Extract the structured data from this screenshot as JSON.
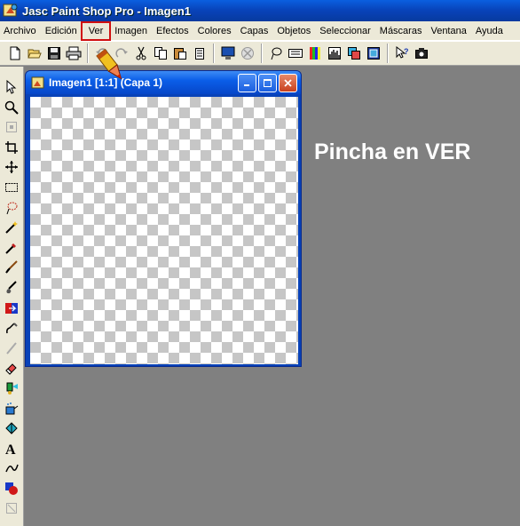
{
  "window": {
    "title": "Jasc Paint Shop Pro - Imagen1",
    "app_icon": "paint-shop-pro-icon"
  },
  "menu": {
    "items": [
      "Archivo",
      "Edición",
      "Ver",
      "Imagen",
      "Efectos",
      "Colores",
      "Capas",
      "Objetos",
      "Seleccionar",
      "Máscaras",
      "Ventana",
      "Ayuda"
    ],
    "highlighted": "Ver",
    "highlight_color": "#d01010"
  },
  "toolbar": {
    "icons": [
      "new-file-icon",
      "open-folder-icon",
      "save-icon",
      "print-icon",
      "undo-icon",
      "redo-icon",
      "cut-icon",
      "copy-icon",
      "paste-icon",
      "delete-icon",
      "monitor-icon",
      "stop-icon",
      "lasso-icon",
      "toolbar-toggle-icon",
      "color-palette-icon",
      "histogram-icon",
      "layers-icon",
      "overview-icon",
      "help-pointer-icon",
      "camera-icon"
    ]
  },
  "tools": {
    "icons": [
      "arrow-icon",
      "zoom-icon",
      "deform-icon",
      "crop-icon",
      "move-icon",
      "selection-icon",
      "freehand-select-icon",
      "magic-wand-icon",
      "dropper-icon",
      "brush-icon",
      "clone-icon",
      "color-replace-icon",
      "retouch-icon",
      "scratch-remover-icon",
      "eraser-icon",
      "picture-tube-icon",
      "airbrush-icon",
      "flood-fill-icon",
      "text-icon",
      "draw-icon",
      "preset-shapes-icon",
      "object-selector-icon"
    ]
  },
  "document": {
    "title": "Imagen1 [1:1] (Capa 1)",
    "buttons": {
      "minimize": "minimize-icon",
      "maximize": "maximize-icon",
      "close": "close-icon"
    }
  },
  "instruction": {
    "text": "Pincha en VER"
  },
  "colors": {
    "workspace": "#808080",
    "titlebar": "#0842b8",
    "menu_bg": "#ece9d8",
    "accent_red": "#d01010"
  }
}
